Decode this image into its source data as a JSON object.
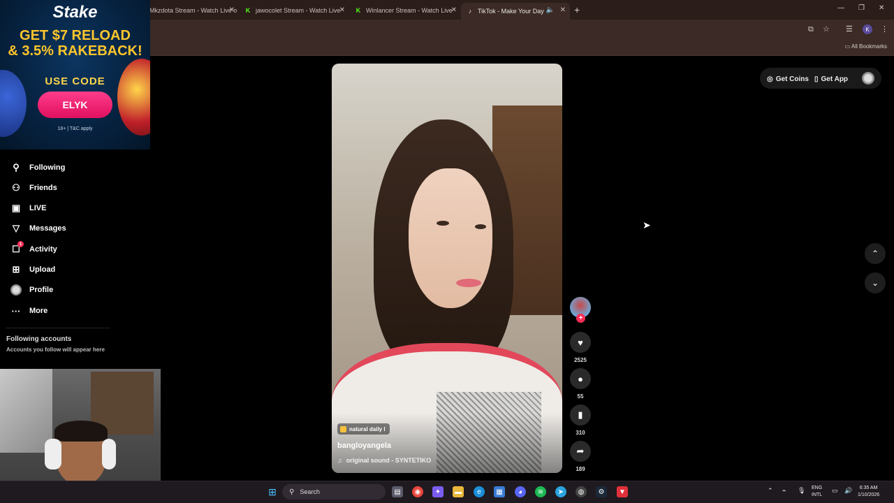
{
  "browser": {
    "tabs": [
      {
        "title": "Mkzdota Stream - Watch Live o",
        "favicon": "kick-icon"
      },
      {
        "title": "jawocolet Stream - Watch Live",
        "favicon": "kick-icon"
      },
      {
        "title": "Winlancer Stream - Watch Live",
        "favicon": "kick-icon"
      },
      {
        "title": "TikTok - Make Your Day",
        "favicon": "tiktok-icon",
        "active": true
      }
    ],
    "profile_initial": "K",
    "all_bookmarks": "All Bookmarks"
  },
  "ad": {
    "brand": "Stake",
    "headline_1": "GET $7 RELOAD",
    "headline_2": "& 3.5% RAKEBACK!",
    "use_code": "USE CODE",
    "code": "ELYK",
    "terms": "18+ | T&C apply"
  },
  "sidebar": {
    "items": [
      {
        "label": "Following",
        "icon": "person-icon"
      },
      {
        "label": "Friends",
        "icon": "friends-icon"
      },
      {
        "label": "LIVE",
        "icon": "live-icon"
      },
      {
        "label": "Messages",
        "icon": "messages-icon"
      },
      {
        "label": "Activity",
        "icon": "activity-icon",
        "badge": "1"
      },
      {
        "label": "Upload",
        "icon": "upload-icon"
      },
      {
        "label": "Profile",
        "icon": "avatar"
      },
      {
        "label": "More",
        "icon": "more-icon"
      }
    ],
    "following_accounts_title": "Following accounts",
    "following_accounts_sub": "Accounts you follow will appear here"
  },
  "header": {
    "get_coins": "Get Coins",
    "get_app": "Get App"
  },
  "video": {
    "tag": "natural daily l",
    "author": "bangloyangela",
    "sound": "original sound - SYNTETIKO"
  },
  "actions": {
    "likes": "2525",
    "comments": "55",
    "saves": "310",
    "shares": "189"
  },
  "taskbar": {
    "search_placeholder": "Search",
    "lang_1": "ENG",
    "lang_2": "INTL",
    "time": "6:35 AM",
    "date": "1/10/2026"
  }
}
